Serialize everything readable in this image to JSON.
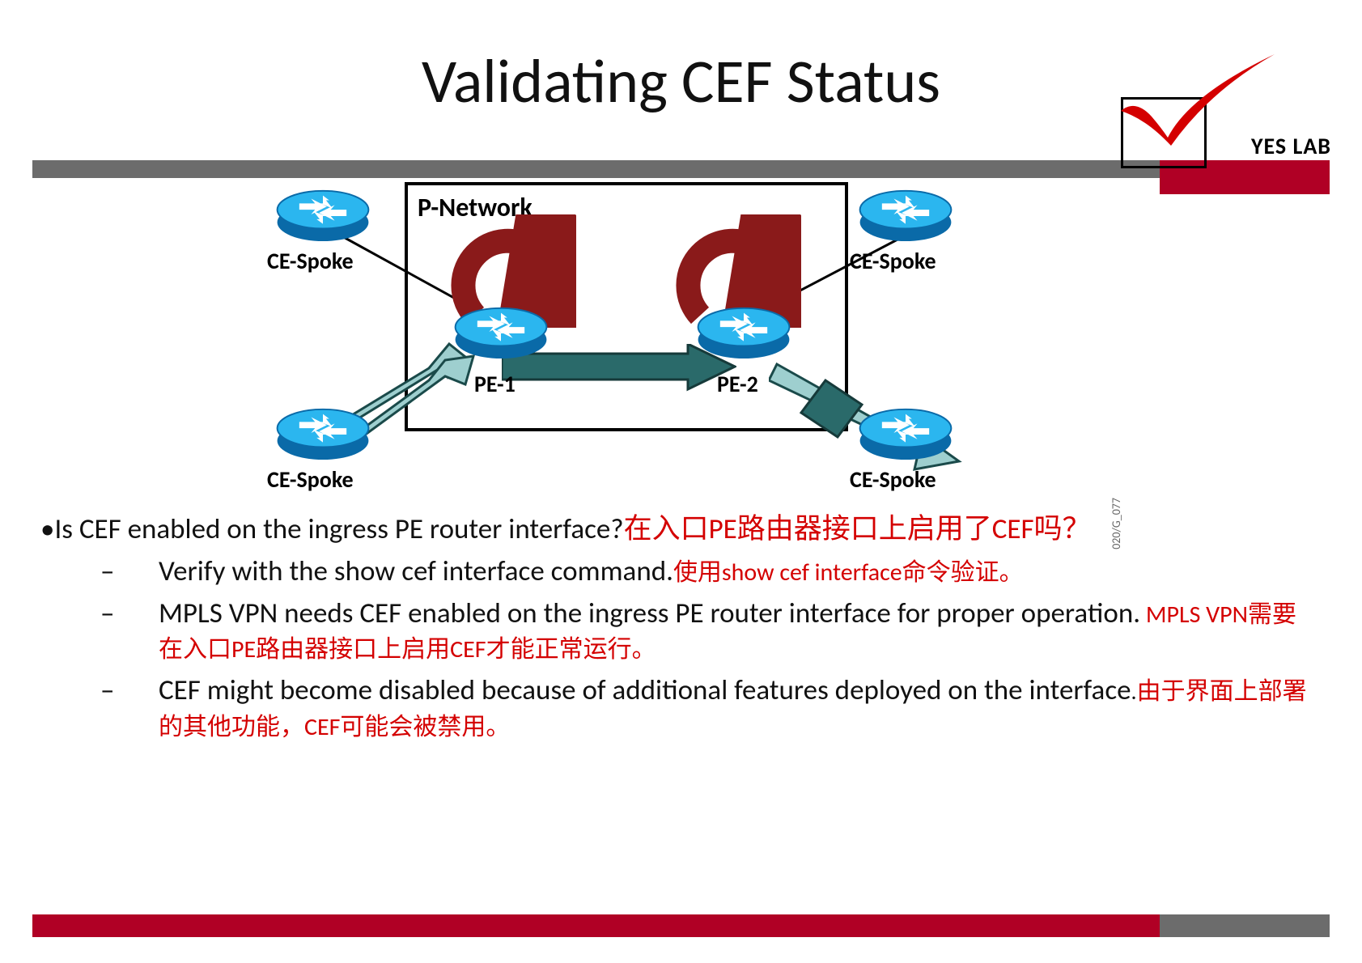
{
  "title": "Validating CEF Status",
  "logo": {
    "text": "YES LAB"
  },
  "diagram": {
    "p_network": "P-Network",
    "ce_spoke_tl": "CE-Spoke",
    "ce_spoke_tr": "CE-Spoke",
    "ce_spoke_bl": "CE-Spoke",
    "ce_spoke_br": "CE-Spoke",
    "pe1": "PE-1",
    "pe2": "PE-2",
    "ref": "020/G_077"
  },
  "body": {
    "b1_en": "Is CEF enabled on the ingress PE router interface?",
    "b1_zh": "在入口PE路由器接口上启用了CEF吗？",
    "s1_en": "Verify with the show cef interface command.",
    "s1_zh": "使用show cef interface命令验证。",
    "s2_en": "MPLS VPN needs CEF enabled on the ingress PE router  interface for proper operation.",
    "s2_zh": " MPLS VPN需要在入口PE路由器接口上启用CEF才能正常运行。",
    "s3_en": "CEF might become disabled because of additional features  deployed on the interface",
    "s3_zh": "由于界面上部署的其他功能，CEF可能会被禁用。"
  }
}
